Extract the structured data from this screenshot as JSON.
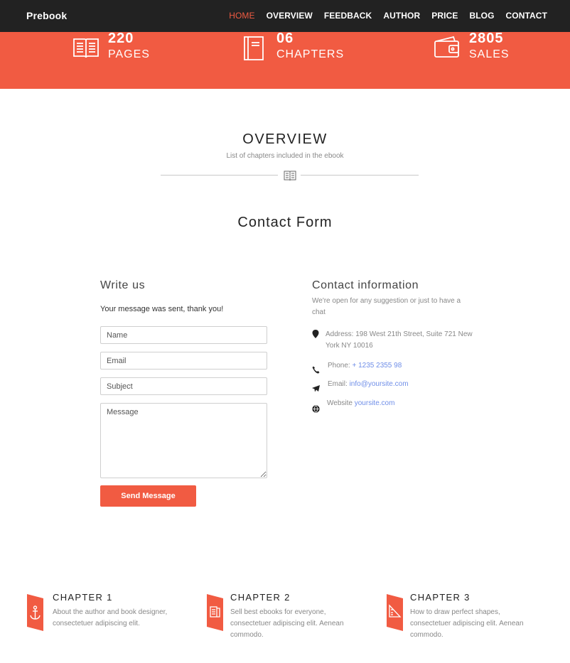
{
  "nav": {
    "brand": "Prebook",
    "items": [
      {
        "label": "HOME",
        "active": true
      },
      {
        "label": "OVERVIEW",
        "active": false
      },
      {
        "label": "FEEDBACK",
        "active": false
      },
      {
        "label": "AUTHOR",
        "active": false
      },
      {
        "label": "PRICE",
        "active": false
      },
      {
        "label": "BLOG",
        "active": false
      },
      {
        "label": "CONTACT",
        "active": false
      }
    ]
  },
  "stats": [
    {
      "number": "220",
      "label": "PAGES",
      "icon": "open-book-icon"
    },
    {
      "number": "06",
      "label": "CHAPTERS",
      "icon": "closed-book-icon"
    },
    {
      "number": "2805",
      "label": "SALES",
      "icon": "wallet-icon"
    }
  ],
  "overview": {
    "title": "OVERVIEW",
    "subtitle": "List of chapters included in the ebook"
  },
  "contact_form": {
    "title": "Contact Form",
    "write_title": "Write us",
    "sent_message": "Your message was sent, thank you!",
    "name_placeholder": "Name",
    "email_placeholder": "Email",
    "subject_placeholder": "Subject",
    "message_placeholder": "Message",
    "send_label": "Send Message"
  },
  "contact_info": {
    "title": "Contact information",
    "intro": "We're open for any suggestion or just to have a chat",
    "address": "Address: 198 West 21th Street, Suite 721 New York NY 10016",
    "phone_label": "Phone:",
    "phone": "+ 1235 2355 98",
    "email_label": "Email:",
    "email": "info@yoursite.com",
    "website_label": "Website",
    "website": "yoursite.com"
  },
  "chapters": [
    {
      "title": "CHAPTER 1",
      "desc": "About the author and book designer, consectetuer adipiscing elit.",
      "icon": "anchor-icon"
    },
    {
      "title": "CHAPTER 2",
      "desc": "Sell best ebooks for everyone, consectetuer adipiscing elit. Aenean commodo.",
      "icon": "document-icon"
    },
    {
      "title": "CHAPTER 3",
      "desc": "How to draw perfect shapes, consectetuer adipiscing elit. Aenean commodo.",
      "icon": "ruler-icon"
    }
  ],
  "colors": {
    "accent": "#f15b42",
    "navbar": "#222222",
    "link": "#6f8ee8"
  }
}
